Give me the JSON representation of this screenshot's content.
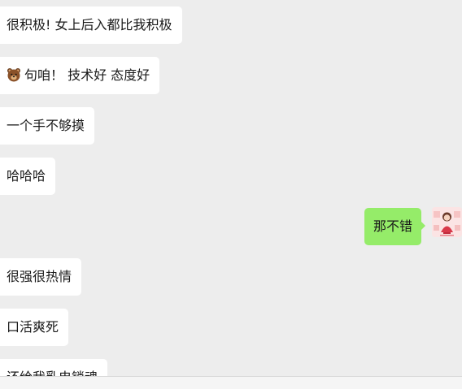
{
  "messages": [
    {
      "side": "in",
      "text": "很积极! 女上后入都比我积极"
    },
    {
      "side": "in",
      "emoji": "bear-face-icon",
      "text": "句咱！  技术好 态度好"
    },
    {
      "side": "in",
      "text": "一个手不够摸"
    },
    {
      "side": "in",
      "text": "哈哈哈"
    },
    {
      "side": "out",
      "text": "那不错"
    },
    {
      "side": "in",
      "text": "很强很热情"
    },
    {
      "side": "in",
      "text": "口活爽死"
    },
    {
      "side": "in",
      "text": "还给我乳电锁魂"
    }
  ],
  "colors": {
    "background": "#ededed",
    "incoming_bubble": "#ffffff",
    "outgoing_bubble": "#95ec69",
    "text": "#191919"
  }
}
